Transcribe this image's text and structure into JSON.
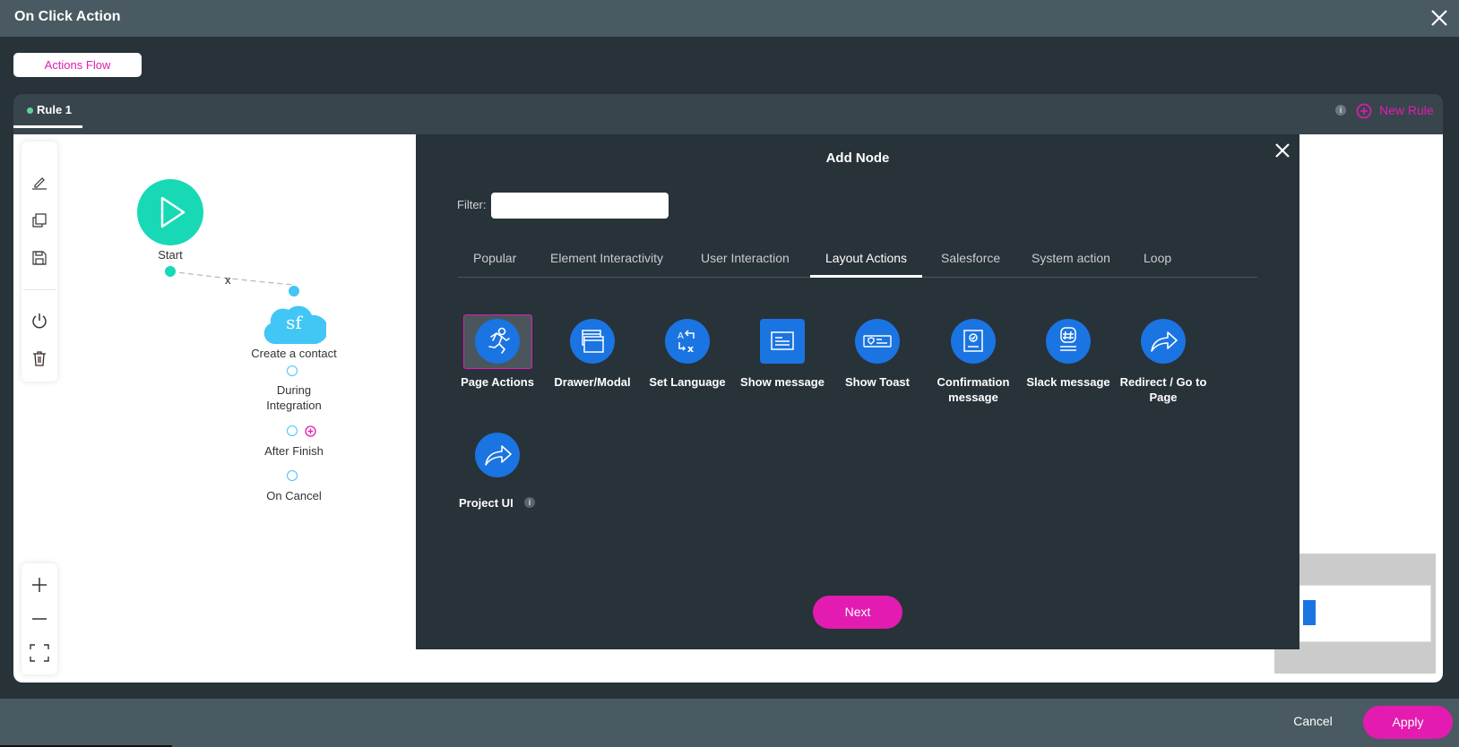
{
  "window": {
    "title": "On Click Action",
    "close_icon": "close-icon"
  },
  "mode_button": {
    "label": "Actions Flow"
  },
  "rules": {
    "tabs": [
      {
        "label": "Rule 1",
        "active": true,
        "status_color": "#5fd39a"
      }
    ],
    "info_icon": "i",
    "new_rule_label": "New Rule"
  },
  "canvas_toolbar": {
    "items": [
      "edit-icon",
      "copy-icon",
      "save-icon",
      "power-icon",
      "delete-icon"
    ],
    "zoom_items": [
      "zoom-in-icon",
      "zoom-out-icon",
      "fit-screen-icon"
    ]
  },
  "flow": {
    "start": {
      "label": "Start",
      "color": "#17d9b5"
    },
    "connector_label": "x",
    "node": {
      "icon_text": "sf",
      "label": "Create a contact",
      "color": "#41c6f5",
      "outputs": [
        {
          "line1": "During",
          "line2": "Integration"
        },
        {
          "line1": "After Finish",
          "line2": ""
        },
        {
          "line1": "On Cancel",
          "line2": ""
        }
      ]
    }
  },
  "dialog": {
    "title": "Add Node",
    "filter_label": "Filter:",
    "filter_value": "",
    "filter_placeholder": "",
    "tabs": [
      {
        "label": "Popular",
        "active": false
      },
      {
        "label": "Element Interactivity",
        "active": false
      },
      {
        "label": "User Interaction",
        "active": false
      },
      {
        "label": "Layout Actions",
        "active": true
      },
      {
        "label": "Salesforce",
        "active": false
      },
      {
        "label": "System action",
        "active": false
      },
      {
        "label": "Loop",
        "active": false
      }
    ],
    "items": [
      {
        "label": "Page Actions",
        "icon": "running-person-icon",
        "selected": true
      },
      {
        "label": "Drawer/Modal",
        "icon": "windows-icon",
        "selected": false
      },
      {
        "label": "Set Language",
        "icon": "translate-icon",
        "selected": false
      },
      {
        "label": "Show message",
        "icon": "message-box-icon",
        "selected": false
      },
      {
        "label": "Show Toast",
        "icon": "toast-icon",
        "selected": false
      },
      {
        "label": "Confirmation message",
        "icon": "confirmation-icon",
        "selected": false
      },
      {
        "label": "Slack message",
        "icon": "slack-icon",
        "selected": false
      },
      {
        "label": "Redirect / Go to Page",
        "icon": "redirect-arrow-icon",
        "selected": false
      },
      {
        "label": "Project UI",
        "icon": "redirect-arrow-icon",
        "selected": false,
        "info": "i"
      }
    ],
    "next_label": "Next"
  },
  "footer": {
    "cancel_label": "Cancel",
    "apply_label": "Apply"
  },
  "colors": {
    "accent": "#e31bb0",
    "icon_blue": "#1a74e2",
    "dark_bg": "#283239",
    "header_bg": "#4a5a62"
  }
}
